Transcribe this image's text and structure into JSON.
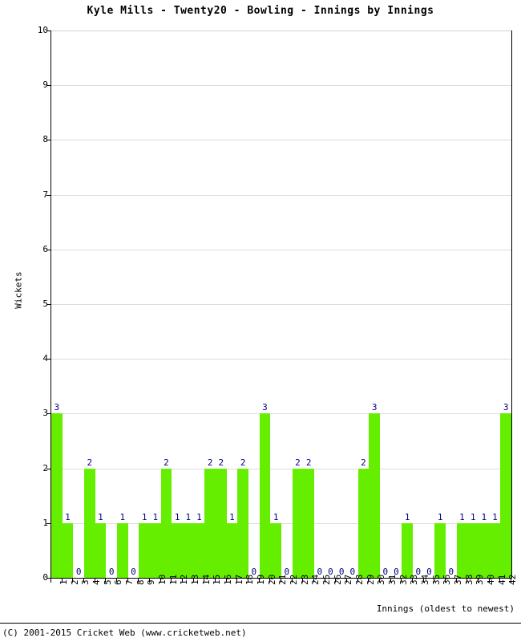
{
  "chart_data": {
    "type": "bar",
    "title": "Kyle Mills - Twenty20 - Bowling - Innings by Innings",
    "xlabel": "Innings (oldest to newest)",
    "ylabel": "Wickets",
    "ylim": [
      0,
      10
    ],
    "ytick_labels": [
      "0",
      "1",
      "2",
      "3",
      "4",
      "5",
      "6",
      "7",
      "8",
      "9",
      "10"
    ],
    "yticks": [
      0,
      1,
      2,
      3,
      4,
      5,
      6,
      7,
      8,
      9,
      10
    ],
    "grid": true,
    "legend": "none",
    "bar_color": "#66ee00",
    "value_label_color": "#000080",
    "categories": [
      "1",
      "2",
      "3",
      "4",
      "5",
      "6",
      "7",
      "8",
      "9",
      "10",
      "11",
      "12",
      "13",
      "14",
      "15",
      "16",
      "17",
      "18",
      "19",
      "20",
      "21",
      "22",
      "23",
      "24",
      "25",
      "26",
      "27",
      "28",
      "29",
      "30",
      "31",
      "32",
      "33",
      "34",
      "35",
      "36",
      "37",
      "38",
      "39",
      "40",
      "41",
      "42"
    ],
    "values": [
      3,
      1,
      0,
      2,
      1,
      0,
      1,
      0,
      1,
      1,
      2,
      1,
      1,
      1,
      2,
      2,
      1,
      2,
      0,
      3,
      1,
      0,
      2,
      2,
      0,
      0,
      0,
      0,
      2,
      3,
      0,
      0,
      1,
      0,
      0,
      1,
      0,
      1,
      1,
      1,
      1,
      3
    ]
  },
  "footer": {
    "copyright": "(C) 2001-2015 Cricket Web (www.cricketweb.net)"
  }
}
